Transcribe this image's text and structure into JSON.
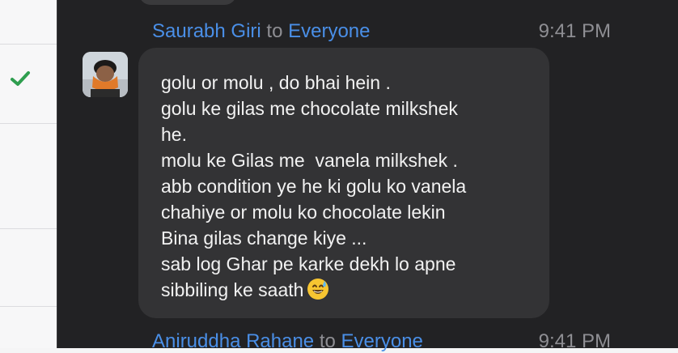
{
  "message": {
    "sender": "Saurabh Giri",
    "to_word": "to",
    "audience": "Everyone",
    "time": "9:41 PM",
    "lines": [
      "golu or molu , do bhai hein .",
      "golu ke gilas me chocolate milkshek",
      "he.",
      "molu ke Gilas me  vanela milkshek .",
      "abb condition ye he ki golu ko vanela",
      "chahiye or molu ko chocolate lekin",
      "Bina gilas change kiye ...",
      "sab log Ghar pe karke dekh lo apne",
      "sibbiling ke saath"
    ],
    "emoji": "sweat-smile-emoji"
  },
  "next_message": {
    "sender": "Aniruddha Rahane",
    "to_word": "to",
    "audience": "Everyone",
    "time": "9:41 PM"
  },
  "colors": {
    "name_accent": "#4a8fe7",
    "panel_bg": "#222224",
    "bubble_bg": "#333335",
    "check_green": "#2f9e4f"
  }
}
